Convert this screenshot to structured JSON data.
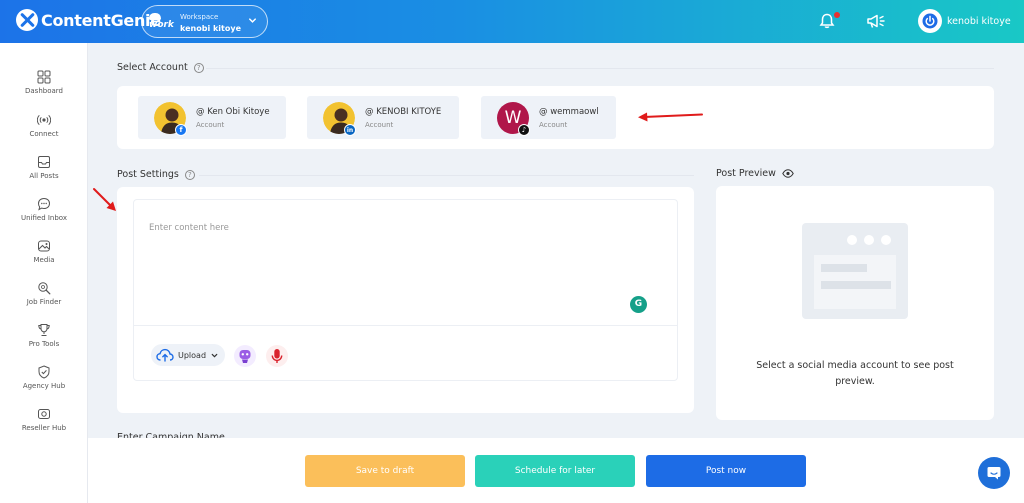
{
  "header": {
    "app_name": "ContentGenie",
    "workspace_logo": "work",
    "workspace_label": "Workspace",
    "workspace_name": "kenobi kitoye",
    "user_name": "kenobi kitoye",
    "icons": [
      "bell-icon",
      "megaphone-icon",
      "power-icon"
    ],
    "notification_dot_color": "#e8302f"
  },
  "sidebar": {
    "items": [
      {
        "label": "Dashboard",
        "icon": "grid-icon"
      },
      {
        "label": "Connect",
        "icon": "broadcast-icon"
      },
      {
        "label": "All Posts",
        "icon": "inbox-icon"
      },
      {
        "label": "Unified Inbox",
        "icon": "chat-icon"
      },
      {
        "label": "Media",
        "icon": "image-icon"
      },
      {
        "label": "Job Finder",
        "icon": "search-icon"
      },
      {
        "label": "Pro Tools",
        "icon": "trophy-icon"
      },
      {
        "label": "Agency Hub",
        "icon": "shield-icon"
      },
      {
        "label": "Reseller Hub",
        "icon": "camera-icon"
      }
    ]
  },
  "select_account": {
    "title": "Select Account",
    "help_glyph": "?",
    "accounts": [
      {
        "handle": "@ Ken Obi Kitoye",
        "type": "Account",
        "network": "facebook",
        "badge": "f",
        "badge_color": "#1877f2"
      },
      {
        "handle": "@ KENOBI KITOYE",
        "type": "Account",
        "network": "linkedin",
        "badge": "in",
        "badge_color": "#0a66c2"
      },
      {
        "handle": "@ wemmaowl",
        "type": "Account",
        "network": "tiktok",
        "badge": "♪",
        "badge_color": "#111111",
        "avatar_letter": "W",
        "avatar_color": "#b0174a"
      }
    ]
  },
  "post_settings": {
    "title": "Post Settings",
    "help_glyph": "?",
    "content_placeholder": "Enter content here",
    "grammarly_glyph": "G",
    "upload_label": "Upload"
  },
  "post_preview": {
    "title": "Post Preview",
    "message": "Select a social media account to see post preview."
  },
  "campaign": {
    "title": "Enter Campaign Name"
  },
  "footer": {
    "save_draft": "Save to draft",
    "schedule": "Schedule for later",
    "post_now": "Post now",
    "colors": {
      "save_draft": "#fbbf5a",
      "schedule": "#2ad1b9",
      "post_now": "#1d6ce6"
    }
  }
}
